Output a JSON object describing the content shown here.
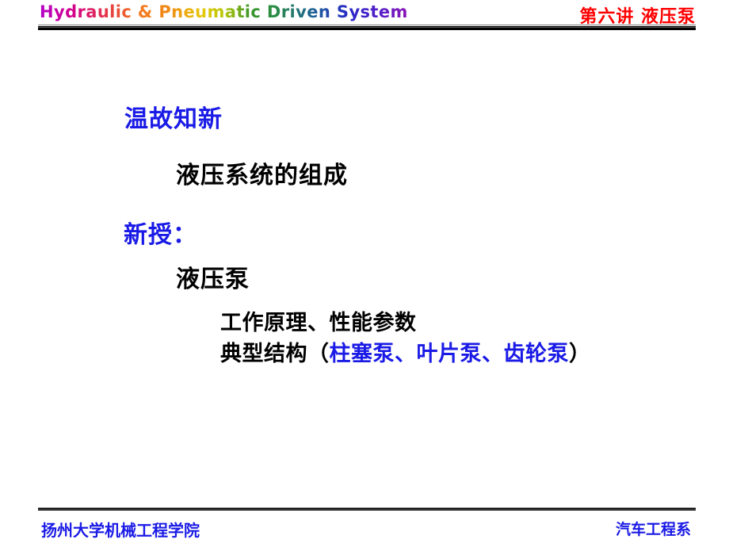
{
  "slide": {
    "header": {
      "wordart_title": "Hydraulic & Pneumatic Driven System",
      "lecture_title": "第六讲  液压泵",
      "lecture_title_color": "#ff0000",
      "rule_color": "#000000"
    },
    "body": {
      "review_heading": "温故知新",
      "review_heading_color": "#1a1ae6",
      "review_item": "液压系统的组成",
      "review_item_color": "#000000",
      "new_heading": "新授：",
      "new_heading_color": "#1a1ae6",
      "new_topic": "液压泵",
      "new_topic_color": "#000000",
      "detail_line_1": "工作原理、性能参数",
      "detail_line_2_prefix": "典型结构（",
      "detail_line_2_highlight": "柱塞泵、叶片泵、齿轮泵",
      "detail_line_2_suffix": "）",
      "detail_highlight_color": "#1a1ae6",
      "detail_text_color": "#000000"
    },
    "footer": {
      "institution": "扬州大学机械工程学院",
      "department": "汽车工程系",
      "text_color": "#1a1ae6",
      "rule_color": "#000000"
    }
  }
}
